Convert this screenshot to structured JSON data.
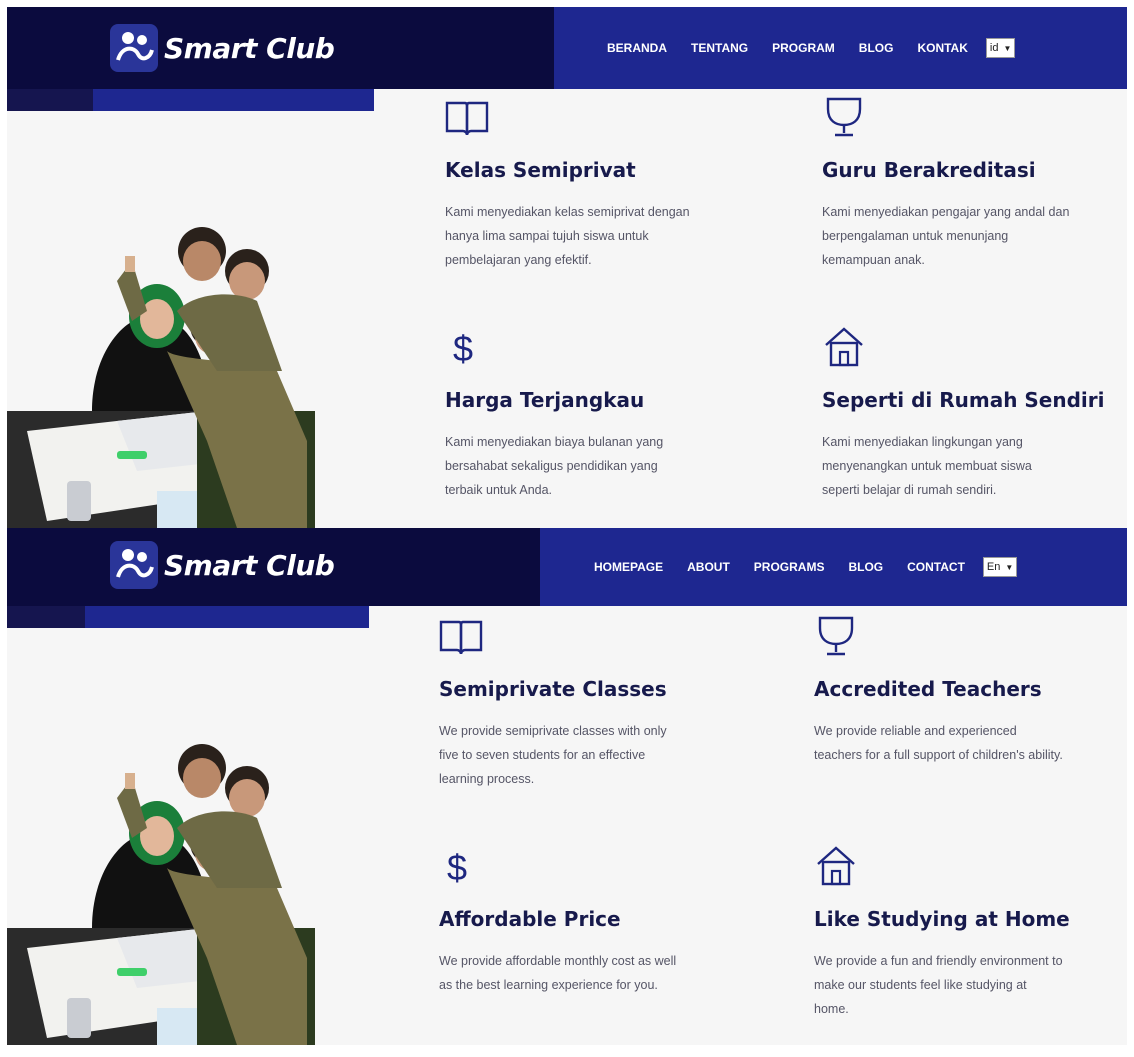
{
  "brand": {
    "name": "Smart Club"
  },
  "colors": {
    "header_dark": "#0b0b3e",
    "header_blue": "#1e2790",
    "heading": "#171a4c",
    "body_text": "#555566",
    "background": "#f6f6f6"
  },
  "id_version": {
    "nav": [
      "BERANDA",
      "TENTANG",
      "PROGRAM",
      "BLOG",
      "KONTAK"
    ],
    "lang": "id",
    "features": [
      {
        "icon": "book-icon",
        "title": "Kelas Semiprivat",
        "text": "Kami menyediakan kelas semiprivat dengan hanya lima sampai tujuh siswa untuk pembelajaran yang efektif."
      },
      {
        "icon": "trophy-icon",
        "title": "Guru Berakreditasi",
        "text": "Kami menyediakan pengajar yang andal dan berpengalaman untuk menunjang kemampuan anak."
      },
      {
        "icon": "dollar-icon",
        "title": "Harga Terjangkau",
        "text": "Kami menyediakan biaya bulanan yang bersahabat sekaligus pendidikan yang terbaik untuk Anda."
      },
      {
        "icon": "house-icon",
        "title": "Seperti di Rumah Sendiri",
        "text": "Kami menyediakan lingkungan yang menyenangkan untuk membuat siswa seperti belajar di rumah sendiri."
      }
    ]
  },
  "en_version": {
    "nav": [
      "HOMEPAGE",
      "ABOUT",
      "PROGRAMS",
      "BLOG",
      "CONTACT"
    ],
    "lang": "En",
    "features": [
      {
        "icon": "book-icon",
        "title": "Semiprivate Classes",
        "text": "We provide semiprivate classes with only five to seven students for an effective learning process."
      },
      {
        "icon": "trophy-icon",
        "title": "Accredited Teachers",
        "text": "We provide reliable and experienced teachers for a full support of children's ability."
      },
      {
        "icon": "dollar-icon",
        "title": "Affordable Price",
        "text": "We provide affordable monthly cost as well as the best learning experience for you."
      },
      {
        "icon": "house-icon",
        "title": "Like Studying at Home",
        "text": "We provide a fun and friendly environment to make our students feel like studying at home."
      }
    ]
  }
}
